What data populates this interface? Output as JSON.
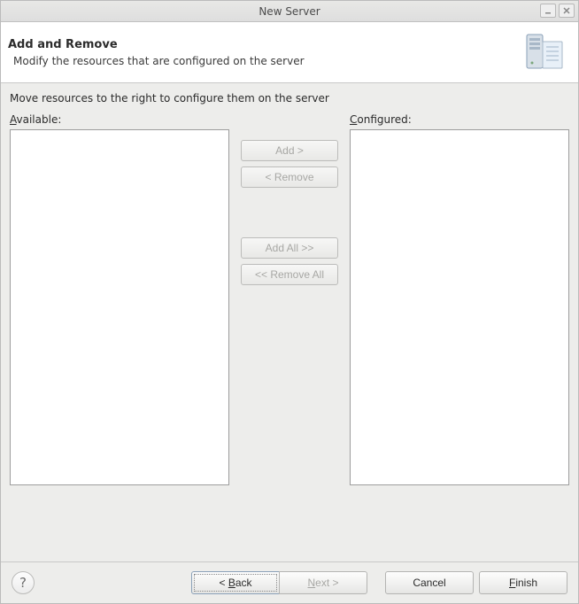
{
  "window": {
    "title": "New Server"
  },
  "header": {
    "title": "Add and Remove",
    "description": "Modify the resources that are configured on the server"
  },
  "content": {
    "instruction": "Move resources to the right to configure them on the server",
    "available_label_pre": "A",
    "available_label_post": "vailable:",
    "configured_label_pre": "C",
    "configured_label_post": "onfigured:"
  },
  "buttons": {
    "add": "Add >",
    "remove": "< Remove",
    "add_all": "Add All >>",
    "remove_all": "<< Remove All",
    "back_pre": "< ",
    "back_mn": "B",
    "back_post": "ack",
    "next_pre": "",
    "next_mn": "N",
    "next_post": "ext >",
    "cancel": "Cancel",
    "finish_pre": "",
    "finish_mn": "F",
    "finish_post": "inish"
  }
}
